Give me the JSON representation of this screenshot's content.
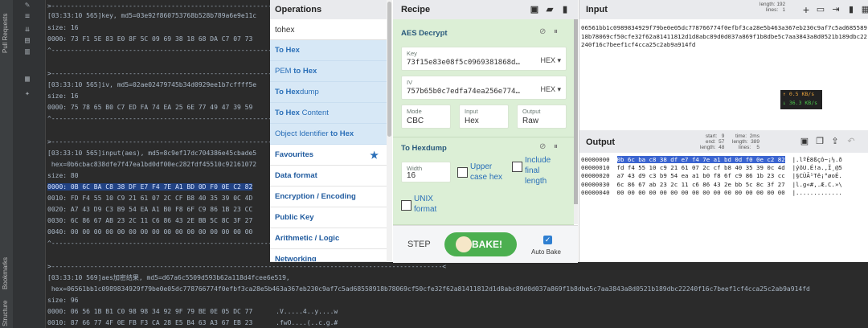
{
  "ide": {
    "left_labels": [
      "Pull Requests",
      "Bookmarks",
      "Structure"
    ]
  },
  "console": {
    "lines": [
      ">-------------------------------------------------------------------------------------------------",
      "[03:33:10 565]key, md5=03e92f860753768b528b789a6e9e11c",
      "size: 16",
      "0000: 73 F1 5E 83 E0 8F 5C 09 69 38 18 68 DA C7 07 73",
      "^-------------------------------------------------------------------------------------------------",
      "",
      ">-------------------------------------------------------------------------------------------------",
      "[03:33:10 565]iv, md5=02ae02479745b34d0929ee1b7cffff5e",
      "size: 16",
      "0000: 75 78 65 B0 C7 ED FA 74 EA 25 6E 77 49 47 39 59",
      "^-------------------------------------------------------------------------------------------------",
      "",
      "",
      ">-------------------------------------------------------------------------------------------------",
      "[03:33:10 565]input(aes), md5=8c9ef17dc704386e45cbade5",
      " hex=0b6cbac838dfe7f47ea1bd0df00ec282fdf45510c92161072",
      "size: 80",
      "0000: 0B 6C BA C8 38 DF E7 F4 7E A1 BD 0D F0 0E C2 82",
      "0010: FD F4 55 10 C9 21 61 07 2C CF B8 40 35 39 0C 4D",
      "0020: A7 43 D9 C3 B9 54 EA A1 B0 F8 6F C9 86 1B 23 CC",
      "0030: 6C 86 67 AB 23 2C 11 C6 86 43 2E BB 5C 8C 3F 27",
      "0040: 00 00 00 00 00 00 00 00 00 00 00 00 00 00 00 00",
      "^-------------------------------------------------------------------------------------------------",
      "",
      "",
      ">-----------------------------------------------------------------------------------------------------<",
      "[03:33:10 569]aes加密结果, md5=d67a6c5509d593b62a118d4fcee6e519,",
      " hex=06561bb1c0989834929f79be0e05dc778766774f0efbf3ca28e5b463a367eb230c9af7c5ad68558918b78069cf50cfe32f62a81411812d1d8abc89d0d037a869f1b8dbe5c7aa3843a8d0521b189dbc22240f16c7beef1cf4cca25c2ab9a914fd",
      "size: 96",
      "0000: 06 56 1B B1 C0 98 98 34 92 9F 79 BE 0E 05 DC 77      .V.....4..y....w",
      "0010: 87 66 77 4F 0E FB F3 CA 28 E5 B4 63 A3 67 EB 23      .fwO....(..c.g.#"
    ]
  },
  "operations": {
    "title": "Operations",
    "search_value": "tohex",
    "results": [
      {
        "pre": "",
        "bold": "To Hex",
        "post": ""
      },
      {
        "pre": "PEM ",
        "bold": "to Hex",
        "post": ""
      },
      {
        "pre": "",
        "bold": "To Hex",
        "post": "dump"
      },
      {
        "pre": "",
        "bold": "To Hex",
        "post": " Content"
      },
      {
        "pre": "Object Identifier ",
        "bold": "to Hex",
        "post": ""
      }
    ],
    "categories": [
      "Favourites",
      "Data format",
      "Encryption / Encoding",
      "Public Key",
      "Arithmetic / Logic",
      "Networking"
    ]
  },
  "recipe": {
    "title": "Recipe",
    "aes": {
      "title": "AES Decrypt",
      "key_label": "Key",
      "key_value": "73f15e83e08f5c0969381868d…",
      "key_format": "HEX ▾",
      "iv_label": "IV",
      "iv_value": "757b65b0c7edfa74ea256e774…",
      "iv_format": "HEX ▾",
      "mode_label": "Mode",
      "mode_value": "CBC",
      "input_label": "Input",
      "input_value": "Hex",
      "output_label": "Output",
      "output_value": "Raw"
    },
    "hexdump": {
      "title": "To Hexdump",
      "width_label": "Width",
      "width_value": "16",
      "upper_label_1": "Upper",
      "upper_label_2": "case hex",
      "include_1": "Include",
      "include_2": "final",
      "include_3": "length",
      "unix_1": "UNIX",
      "unix_2": "format"
    },
    "step_label": "STEP",
    "bake_label": "BAKE!",
    "auto_bake_label": "Auto Bake"
  },
  "input": {
    "title": "Input",
    "stats": "length: 192\n lines:   1",
    "text": "06561bb1c0989834929f79be0e05dc778766774f0efbf3ca28e5b463a367eb230c9af7c5ad68558918b78069cf50cfe32f62a81411812d1d8abc89d0d037a869f1b8dbe5c7aa3843a8d0521b189dbc22240f16c7beef1cf4cca25c2ab9a914fd",
    "speed_up": "↑ 0.5 KB/s",
    "speed_down": "↓ 36.3 KB/s"
  },
  "output": {
    "title": "Output",
    "stats_left": "start:   9\n  end:  57\nlength:  48",
    "stats_right": "time:  2ms\nlength:  389\n lines:    5",
    "rows": [
      {
        "off": "00000000",
        "hex": "0b 6c ba c8 38 df e7 f4 7e a1 bd 0d f0 0e c2 82",
        "asc": "|.lºÈ8ßçô~¡½.ð"
      },
      {
        "off": "00000010",
        "hex": "fd f4 55 10 c9 21 61 07 2c cf b8 40 35 39 0c 4d",
        "asc": "|ýôU.É!a.,Ï¸@5"
      },
      {
        "off": "00000020",
        "hex": "a7 43 d9 c3 b9 54 ea a1 b0 f8 6f c9 86 1b 23 cc",
        "asc": "|§CÙÃ¹Tê¡°øoÉ."
      },
      {
        "off": "00000030",
        "hex": "6c 86 67 ab 23 2c 11 c6 86 43 2e bb 5c 8c 3f 27",
        "asc": "|l.g«#,.Æ.C.»\\"
      },
      {
        "off": "00000040",
        "hex": "00 00 00 00 00 00 00 00 00 00 00 00 00 00 00 00",
        "asc": "|............."
      }
    ]
  },
  "colors": {
    "console_bg": "#2b2b2b",
    "console_text": "#a9b7c6",
    "recipe_block": "#dcefd6",
    "bake": "#4caf50",
    "op_link": "#2a6fb8",
    "selection": "#3a64d0"
  }
}
